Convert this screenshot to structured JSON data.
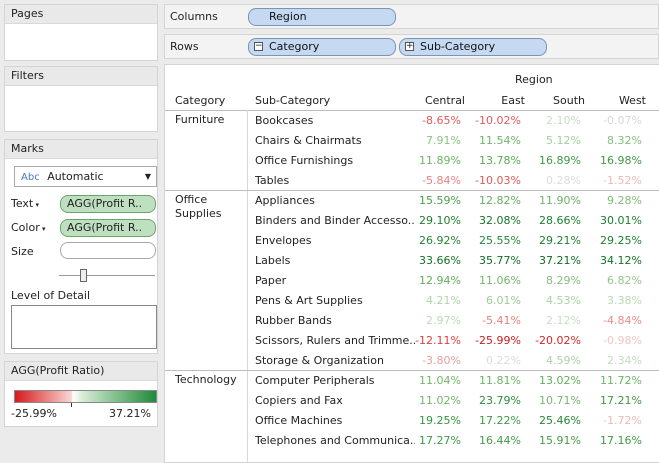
{
  "cards": {
    "pages_title": "Pages",
    "filters_title": "Filters",
    "marks_title": "Marks",
    "legend_title": "AGG(Profit Ratio)"
  },
  "marks": {
    "type": "Automatic",
    "type_icon": "Abc",
    "text_label": "Text",
    "text_pill": "AGG(Profit R..",
    "color_label": "Color",
    "color_pill": "AGG(Profit R..",
    "size_label": "Size",
    "lod_label": "Level of Detail"
  },
  "legend": {
    "min": "-25.99%",
    "max": "37.21%",
    "min_color": "#d7191c",
    "max_color": "#1f8a3a"
  },
  "shelves": {
    "columns_label": "Columns",
    "columns_pill": "Region",
    "rows_label": "Rows",
    "rows_pill_1": "Category",
    "rows_pill_2": "Sub-Category"
  },
  "table": {
    "region_header": "Region",
    "col_category": "Category",
    "col_subcategory": "Sub-Category",
    "regions": [
      "Central",
      "East",
      "South",
      "West"
    ],
    "rows": [
      {
        "cat": "Furniture",
        "sub": "Bookcases",
        "vals": [
          "-8.65%",
          "-10.02%",
          "2.10%",
          "-0.07%"
        ],
        "colors": [
          "#e05a5a",
          "#e05a5a",
          "#c6dec3",
          "#d8d8d8"
        ]
      },
      {
        "cat": "",
        "sub": "Chairs & Chairmats",
        "vals": [
          "7.91%",
          "11.54%",
          "5.12%",
          "8.32%"
        ],
        "colors": [
          "#8cc284",
          "#6fb466",
          "#a3cf9c",
          "#85be7d"
        ]
      },
      {
        "cat": "",
        "sub": "Office Furnishings",
        "vals": [
          "11.89%",
          "13.78%",
          "16.89%",
          "16.98%"
        ],
        "colors": [
          "#6db364",
          "#5aaa53",
          "#3e9a42",
          "#3e9a42"
        ]
      },
      {
        "cat": "",
        "sub": "Tables",
        "vals": [
          "-5.84%",
          "-10.03%",
          "0.28%",
          "-1.52%"
        ],
        "colors": [
          "#e88080",
          "#e05a5a",
          "#dcdcdc",
          "#f0b8b8"
        ]
      },
      {
        "cat": "Office\nSupplies",
        "sub": "Appliances",
        "vals": [
          "15.59%",
          "12.82%",
          "11.90%",
          "9.28%"
        ],
        "colors": [
          "#4aa049",
          "#62ae5b",
          "#6db364",
          "#7fbb76"
        ]
      },
      {
        "cat": "",
        "sub": "Binders and Binder Accesso..",
        "vals": [
          "29.10%",
          "32.08%",
          "28.66%",
          "30.01%"
        ],
        "colors": [
          "#1e7f2e",
          "#17752a",
          "#1e7f2e",
          "#1b7b2c"
        ]
      },
      {
        "cat": "",
        "sub": "Envelopes",
        "vals": [
          "26.92%",
          "25.55%",
          "29.21%",
          "29.25%"
        ],
        "colors": [
          "#238333",
          "#268736",
          "#1e7f2e",
          "#1e7f2e"
        ]
      },
      {
        "cat": "",
        "sub": "Labels",
        "vals": [
          "33.66%",
          "35.77%",
          "37.21%",
          "34.12%"
        ],
        "colors": [
          "#147128",
          "#126d26",
          "#106a24",
          "#147128"
        ]
      },
      {
        "cat": "",
        "sub": "Paper",
        "vals": [
          "12.94%",
          "11.06%",
          "8.29%",
          "6.82%"
        ],
        "colors": [
          "#62ae5b",
          "#72b66a",
          "#85be7d",
          "#94c58c"
        ]
      },
      {
        "cat": "",
        "sub": "Pens & Art Supplies",
        "vals": [
          "4.21%",
          "6.01%",
          "4.53%",
          "3.38%"
        ],
        "colors": [
          "#aed4a8",
          "#9ccb95",
          "#abd2a5",
          "#b8d9b2"
        ]
      },
      {
        "cat": "",
        "sub": "Rubber Bands",
        "vals": [
          "2.97%",
          "-5.41%",
          "2.12%",
          "-4.84%"
        ],
        "colors": [
          "#bcdbb6",
          "#e88080",
          "#c6dec3",
          "#ea8a8a"
        ]
      },
      {
        "cat": "",
        "sub": "Scissors, Rulers and Trimme..",
        "vals": [
          "-12.11%",
          "-25.99%",
          "-20.02%",
          "-0.98%"
        ],
        "colors": [
          "#d94040",
          "#c81e1e",
          "#d02828",
          "#f2c4c4"
        ]
      },
      {
        "cat": "",
        "sub": "Storage & Organization",
        "vals": [
          "-3.80%",
          "0.22%",
          "4.59%",
          "2.34%"
        ],
        "colors": [
          "#ed9c9c",
          "#dcdcdc",
          "#abd2a5",
          "#c3dcbf"
        ]
      },
      {
        "cat": "Technology",
        "sub": "Computer Peripherals",
        "vals": [
          "11.04%",
          "11.81%",
          "13.02%",
          "11.72%"
        ],
        "colors": [
          "#72b66a",
          "#6db364",
          "#62ae5b",
          "#6db364"
        ]
      },
      {
        "cat": "",
        "sub": "Copiers and Fax",
        "vals": [
          "11.02%",
          "23.79%",
          "10.71%",
          "17.21%"
        ],
        "colors": [
          "#72b66a",
          "#2a8b38",
          "#74b76c",
          "#3e9a42"
        ]
      },
      {
        "cat": "",
        "sub": "Office Machines",
        "vals": [
          "19.25%",
          "17.22%",
          "25.46%",
          "-1.72%"
        ],
        "colors": [
          "#359440",
          "#3e9a42",
          "#268736",
          "#f0b8b8"
        ]
      },
      {
        "cat": "",
        "sub": "Telephones and Communica..",
        "vals": [
          "17.27%",
          "16.44%",
          "15.91%",
          "17.16%"
        ],
        "colors": [
          "#3e9a42",
          "#439c45",
          "#479e47",
          "#3e9a42"
        ]
      }
    ]
  }
}
